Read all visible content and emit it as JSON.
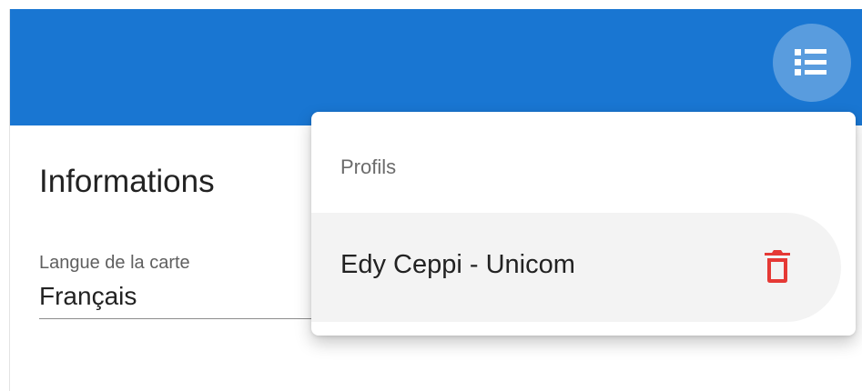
{
  "header": {
    "menu_icon": "list-icon",
    "background_color": "#1976d2"
  },
  "content": {
    "section_title": "Informations",
    "map_language": {
      "label": "Langue de la carte",
      "value": "Français"
    }
  },
  "profiles_menu": {
    "header": "Profils",
    "items": [
      {
        "label": "Edy Ceppi - Unicom",
        "delete_icon": "trash-icon",
        "delete_color": "#e53935"
      }
    ]
  }
}
